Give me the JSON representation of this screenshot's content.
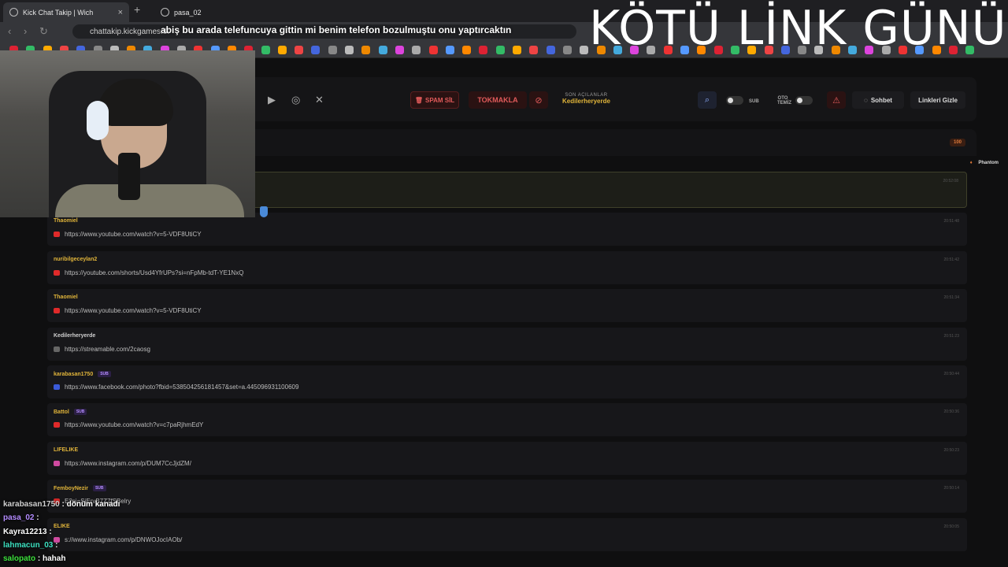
{
  "browser": {
    "active_tab_title": "Kick Chat Takip | Wich",
    "inactive_tab_title": "pasa_02",
    "url": "chattakip.kickgames.tk"
  },
  "overlay": {
    "big_title": "KÖTÜ LİNK GÜNÜ",
    "caption": "abiş bu arada telefuncuya gittin mi benim telefon bozulmuştu onu yaptırcaktın"
  },
  "toolbar": {
    "spam_label": "SPAM SİL",
    "tokmakla_label": "TOKMAKLA",
    "son_acilanlar_label": "SON AÇILANLAR",
    "son_acilanlar_value": "Kedilerheryerde",
    "sub_label": "SUB",
    "oto_temiz_label": "OTO TEMİZ",
    "sohbet_label": "Sohbet",
    "linkleri_gizle_label": "Linkleri Gizle"
  },
  "panel": {
    "count": "100",
    "streamer_tag": "Phantom"
  },
  "links": [
    {
      "user": "",
      "sub": false,
      "link": "",
      "time": "20:52:08",
      "source": "",
      "user_color": "#e0b43a"
    },
    {
      "user": "Thaomiel",
      "sub": false,
      "link": "https://www.youtube.com/watch?v=5-VDF8UtiCY",
      "time": "20:51:48",
      "source": "youtube",
      "user_color": "#e0b43a"
    },
    {
      "user": "nuribilgeceylan2",
      "sub": false,
      "link": "https://youtube.com/shorts/Usd4YfrUPs?si=nFpMb-tdT-YE1NxQ",
      "time": "20:51:42",
      "source": "youtube",
      "user_color": "#e0b43a"
    },
    {
      "user": "Thaomiel",
      "sub": false,
      "link": "https://www.youtube.com/watch?v=5-VDF8UtiCY",
      "time": "20:51:34",
      "source": "youtube",
      "user_color": "#e0b43a"
    },
    {
      "user": "Kedilerheryerde",
      "sub": false,
      "link": "https://streamable.com/2caosg",
      "time": "20:51:23",
      "source": "streamable",
      "user_color": "#cfcfcf"
    },
    {
      "user": "karabasan1750",
      "sub": true,
      "link": "https://www.facebook.com/photo?fbid=538504256181457&set=a.445096931100609",
      "time": "20:50:44",
      "source": "facebook",
      "user_color": "#e0b43a"
    },
    {
      "user": "Battol",
      "sub": true,
      "link": "https://www.youtube.com/watch?v=c7paRjhmEdY",
      "time": "20:50:36",
      "source": "youtube",
      "user_color": "#e0b43a"
    },
    {
      "user": "LIFELIKE",
      "sub": false,
      "link": "https://www.instagram.com/p/DUM7CcJjdZM/",
      "time": "20:50:23",
      "source": "instagram",
      "user_color": "#e0b43a"
    },
    {
      "user": "FemboyNezir",
      "sub": true,
      "link": "E?si=SiErvB7Z7fSBelry",
      "time": "20:50:14",
      "source": "youtube",
      "user_color": "#e0b43a"
    },
    {
      "user": "ELIKE",
      "sub": false,
      "link": "s://www.instagram.com/p/DNWOJocIAOb/",
      "time": "20:50:05",
      "source": "instagram",
      "user_color": "#e0b43a"
    }
  ],
  "stream_chat": [
    {
      "name": "karabasan1750",
      "text": "dönüm kanadı",
      "color": "#cfcfcf"
    },
    {
      "name": "pasa_02",
      "text": "",
      "color": "#b48cff"
    },
    {
      "name": "Kayra12213",
      "text": "",
      "color": "#ffffff"
    },
    {
      "name": "lahmacun_03",
      "text": "",
      "color": "#3ce0c0"
    },
    {
      "name": "salopato",
      "text": "hahah",
      "color": "#3ce03c"
    }
  ],
  "source_colors": {
    "youtube": "#e02a2a",
    "instagram": "#d04aa0",
    "facebook": "#3a5ad8",
    "streamable": "#666666"
  }
}
